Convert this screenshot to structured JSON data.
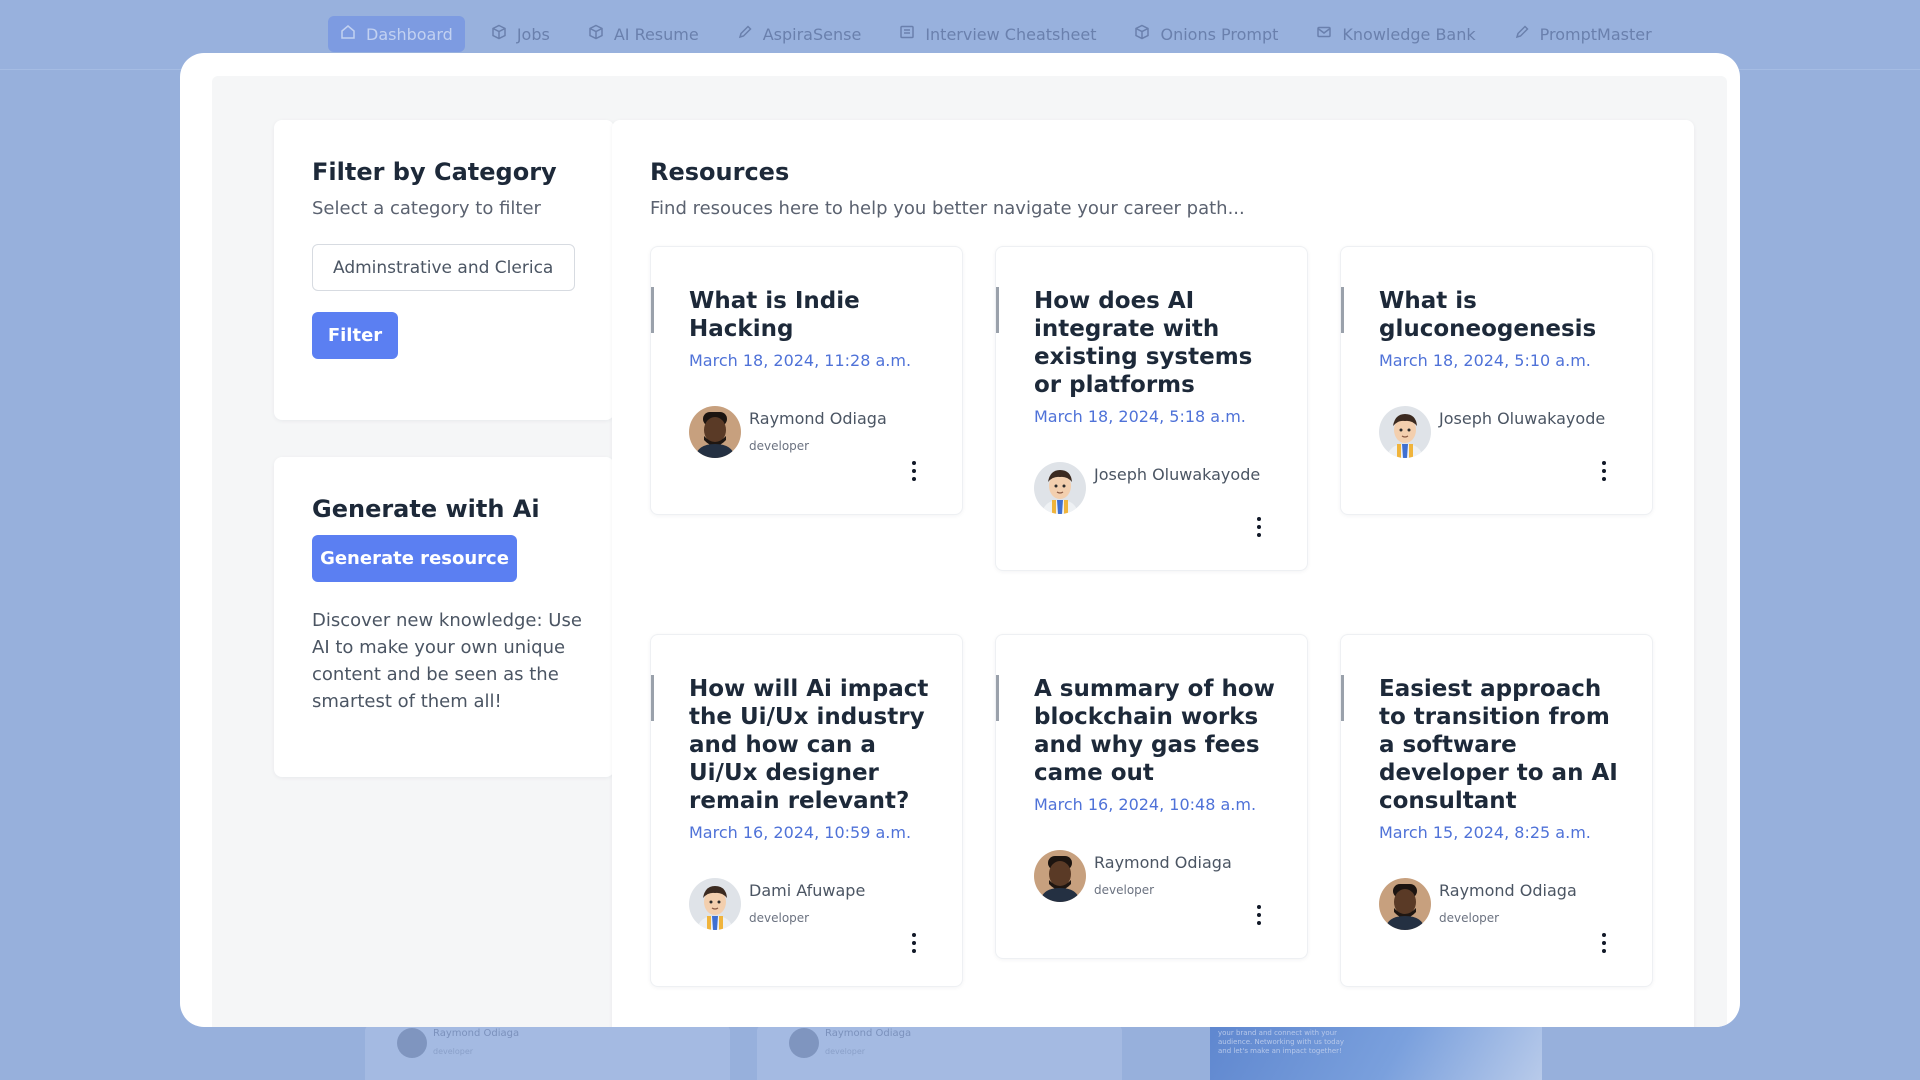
{
  "nav": {
    "items": [
      {
        "label": "Dashboard",
        "icon": "home-icon",
        "active": true
      },
      {
        "label": "Jobs",
        "icon": "cube-icon"
      },
      {
        "label": "AI Resume",
        "icon": "cube-icon"
      },
      {
        "label": "AspiraSense",
        "icon": "pencil-icon"
      },
      {
        "label": "Interview Cheatsheet",
        "icon": "document-icon"
      },
      {
        "label": "Onions Prompt",
        "icon": "cube-icon"
      },
      {
        "label": "Knowledge Bank",
        "icon": "mail-icon"
      },
      {
        "label": "PromptMaster",
        "icon": "pencil-icon"
      }
    ]
  },
  "filter": {
    "title": "Filter by Category",
    "subtitle": "Select a category to filter",
    "selected_value": "Adminstrative and Clerica",
    "button_label": "Filter"
  },
  "generate": {
    "title": "Generate with Ai",
    "button_label": "Generate resource",
    "description": "Discover new knowledge: Use AI to make your own unique content and be seen as the smartest of them all!"
  },
  "resources": {
    "title": "Resources",
    "subtitle": "Find resouces here to help you better navigate your career path...",
    "cards": [
      {
        "title": "What is Indie Hacking",
        "date": "March 18, 2024, 11:28 a.m.",
        "author": "Raymond Odiaga",
        "role": "developer",
        "avatar": "dark"
      },
      {
        "title": "How does AI integrate with existing systems or platforms",
        "date": "March 18, 2024, 5:18 a.m.",
        "author": "Joseph Oluwakayode",
        "role": "",
        "avatar": "cartoon"
      },
      {
        "title": "What is gluconeogenesis",
        "date": "March 18, 2024, 5:10 a.m.",
        "author": "Joseph Oluwakayode",
        "role": "",
        "avatar": "cartoon"
      },
      {
        "title": "How will Ai impact the Ui/Ux industry and how can a Ui/Ux designer remain relevant?",
        "date": "March 16, 2024, 10:59 a.m.",
        "author": "Dami Afuwape",
        "role": "developer",
        "avatar": "cartoon"
      },
      {
        "title": "A summary of how blockchain works and why gas fees came out",
        "date": "March 16, 2024, 10:48 a.m.",
        "author": "Raymond Odiaga",
        "role": "developer",
        "avatar": "dark"
      },
      {
        "title": "Easiest approach to transition from a software developer to an AI consultant",
        "date": "March 15, 2024, 8:25 a.m.",
        "author": "Raymond Odiaga",
        "role": "developer",
        "avatar": "dark"
      }
    ]
  },
  "background": {
    "cards": [
      {
        "author": "Raymond Odiaga",
        "role": "developer"
      },
      {
        "author": "Raymond Odiaga",
        "role": "developer"
      }
    ],
    "image_text": "your brand and connect with your audience. Networking with us today and let's make an impact together!"
  }
}
